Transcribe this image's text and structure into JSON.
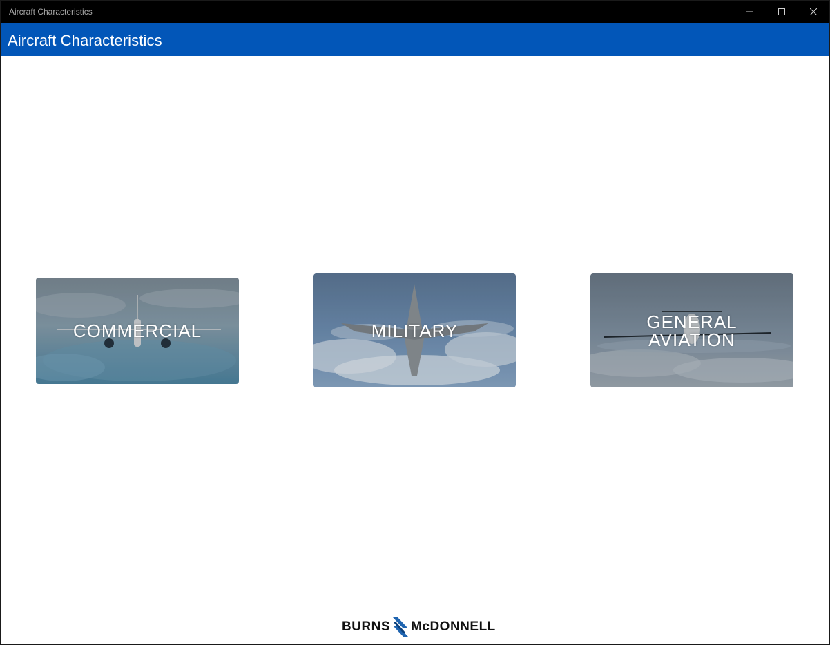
{
  "window": {
    "title": "Aircraft Characteristics",
    "controls": [
      "minimize-icon",
      "maximize-icon",
      "close-icon"
    ]
  },
  "appbar": {
    "title": "Aircraft Characteristics",
    "color": "#0256b8"
  },
  "tiles": [
    {
      "label": "COMMERCIAL"
    },
    {
      "label": "MILITARY"
    },
    {
      "label_line1": "GENERAL",
      "label_line2": "AVIATION"
    }
  ],
  "footer": {
    "logo_left": "BURNS",
    "logo_right": "McDONNELL"
  }
}
